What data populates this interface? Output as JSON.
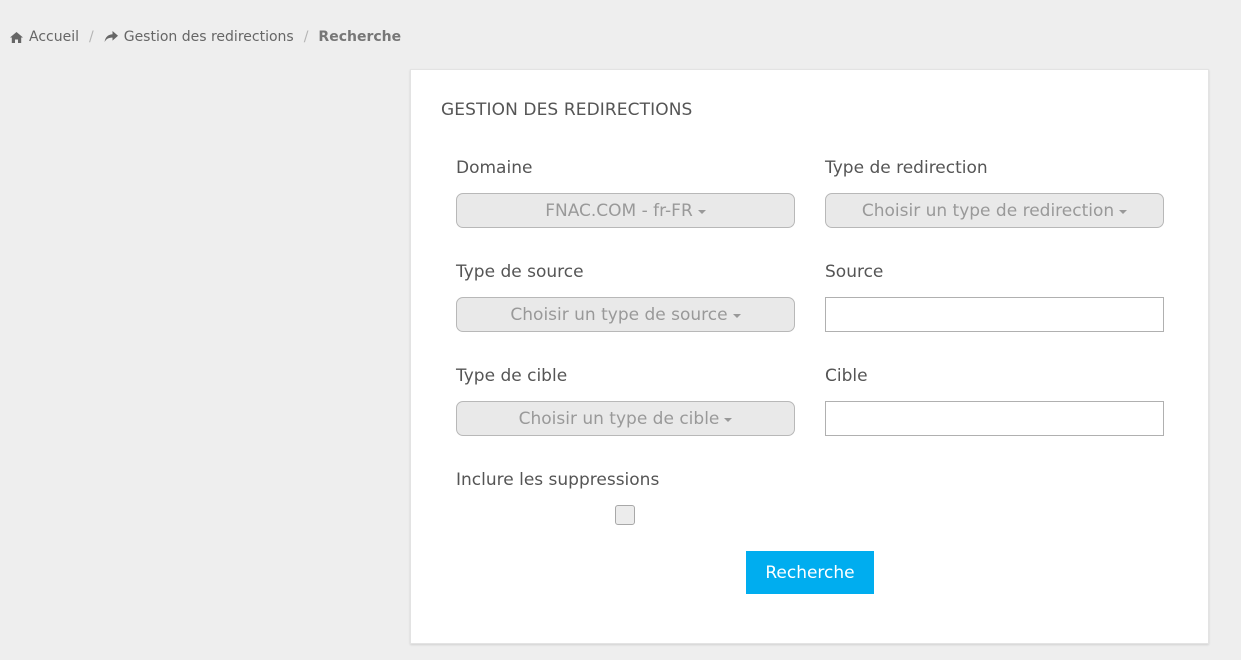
{
  "breadcrumb": {
    "home": "Accueil",
    "redirections": "Gestion des redirections",
    "current": "Recherche",
    "separator": "/"
  },
  "panel": {
    "title": "GESTION DES REDIRECTIONS"
  },
  "form": {
    "domaine": {
      "label": "Domaine",
      "value": "FNAC.COM - fr-FR"
    },
    "type_redirection": {
      "label": "Type de redirection",
      "value": "Choisir un type de redirection"
    },
    "type_source": {
      "label": "Type de source",
      "value": "Choisir un type de source"
    },
    "source": {
      "label": "Source",
      "value": "",
      "placeholder": ""
    },
    "type_cible": {
      "label": "Type de cible",
      "value": "Choisir un type de cible"
    },
    "cible": {
      "label": "Cible",
      "value": "",
      "placeholder": ""
    },
    "inclure_suppressions": {
      "label": "Inclure les suppressions",
      "checked": false
    },
    "submit_label": "Recherche"
  },
  "icons": {
    "home": "home-icon",
    "share": "share-icon",
    "caret": "caret-down-icon"
  },
  "colors": {
    "background": "#eeeeee",
    "panel": "#ffffff",
    "accent": "#00adef",
    "dropdown_bg": "#e9e9e9",
    "dropdown_text": "#999999"
  }
}
